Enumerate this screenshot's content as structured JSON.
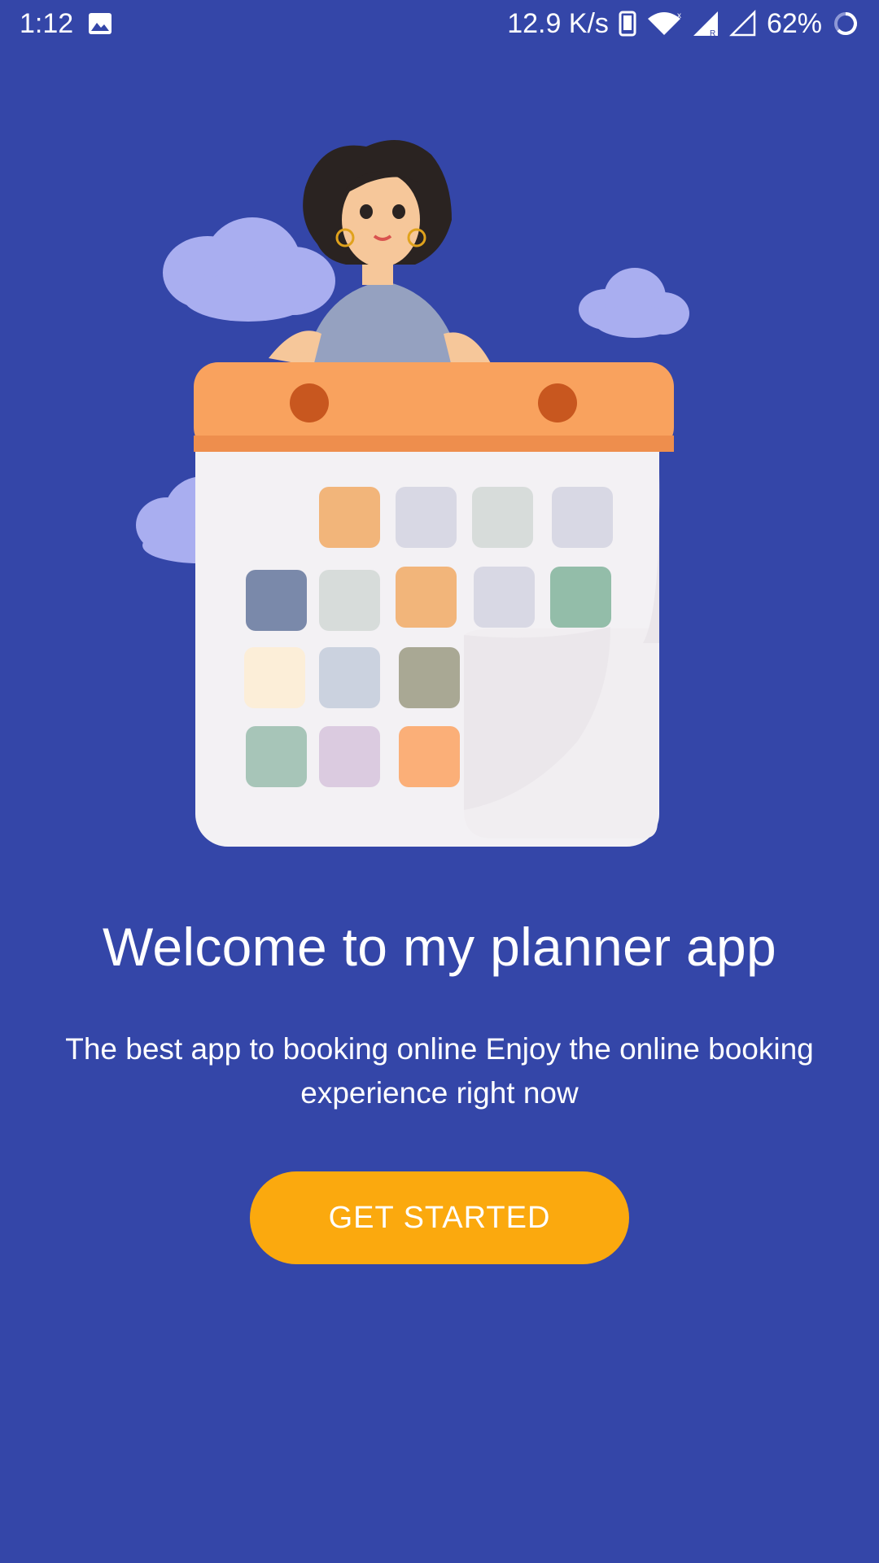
{
  "status_bar": {
    "time": "1:12",
    "network_speed": "12.9 K/s",
    "battery_percent": "62%",
    "icons": [
      "image-icon",
      "phone-icon",
      "wifi-icon",
      "signal-icon",
      "signal-empty-icon",
      "battery-ring-icon"
    ]
  },
  "illustration": {
    "icon": "woman-with-calendar-illustration"
  },
  "welcome": {
    "title": "Welcome to my planner app",
    "subtitle": "The best app to booking online Enjoy the online booking experience right now"
  },
  "actions": {
    "get_started_label": "GET STARTED"
  },
  "colors": {
    "background": "#3446A8",
    "button": "#FBA90E",
    "calendar_header": "#F9A25E"
  }
}
